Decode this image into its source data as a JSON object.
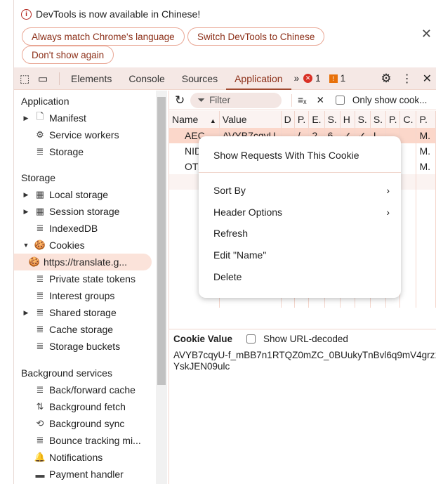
{
  "banner": {
    "text": "DevTools is now available in Chinese!",
    "buttons": [
      "Always match Chrome's language",
      "Switch DevTools to Chinese",
      "Don't show again"
    ]
  },
  "tabs": [
    "Elements",
    "Console",
    "Sources",
    "Application"
  ],
  "active_tab": "Application",
  "errors": "1",
  "warnings": "1",
  "sidebar": {
    "app_header": "Application",
    "app_items": [
      "Manifest",
      "Service workers",
      "Storage"
    ],
    "storage_header": "Storage",
    "storage_items": [
      "Local storage",
      "Session storage",
      "IndexedDB",
      "Cookies",
      "https://translate.g...",
      "Private state tokens",
      "Interest groups",
      "Shared storage",
      "Cache storage",
      "Storage buckets"
    ],
    "bg_header": "Background services",
    "bg_items": [
      "Back/forward cache",
      "Background fetch",
      "Background sync",
      "Bounce tracking mi...",
      "Notifications",
      "Payment handler"
    ]
  },
  "toolbar": {
    "filter_placeholder": "Filter",
    "only_show": "Only show cook..."
  },
  "table": {
    "headers": [
      "Name",
      "Value",
      "D",
      "P.",
      "E.",
      "S.",
      "H",
      "S.",
      "S.",
      "P.",
      "C.",
      "P."
    ],
    "rows": [
      [
        "AEC",
        "AVYB7cqyU",
        "",
        "/",
        "2",
        "6",
        "✓",
        "✓",
        "L",
        "",
        "",
        "M."
      ],
      [
        "NID",
        "",
        "",
        "",
        "",
        "",
        "",
        "",
        "",
        "",
        "",
        "M."
      ],
      [
        "OTZ",
        "",
        "",
        "",
        "",
        "",
        "",
        "",
        "",
        "",
        "",
        "M."
      ]
    ]
  },
  "cookie_value": {
    "label": "Cookie Value",
    "checkbox": "Show URL-decoded",
    "value": "AVYB7cqyU-f_mBB7n1RTQZ0mZC_0BUukyTnBvl6q9mV4grz1YskJEN09ulc"
  },
  "context_menu": [
    "Show Requests With This Cookie",
    "Sort By",
    "Header Options",
    "Refresh",
    "Edit \"Name\"",
    "Delete"
  ]
}
